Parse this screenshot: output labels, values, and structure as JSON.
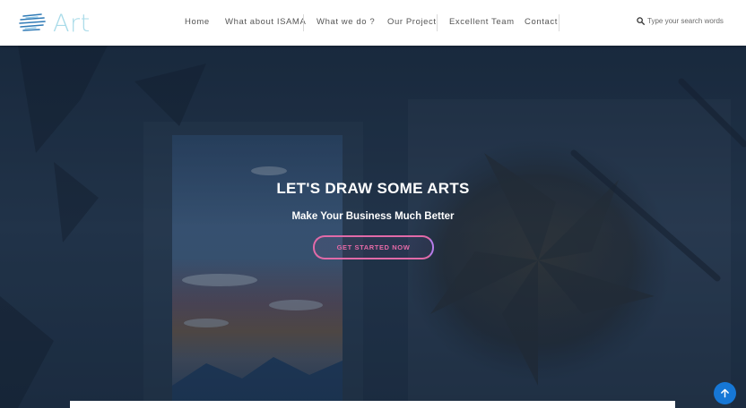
{
  "brand": {
    "name": "Art"
  },
  "nav": {
    "items": [
      "Home",
      "What about ISAMA",
      "What we do ?",
      "Our Project",
      "Excellent Team",
      "Contact"
    ]
  },
  "search": {
    "placeholder": "Type your search words"
  },
  "hero": {
    "title": "LET'S DRAW SOME ARTS",
    "subtitle": "Make Your Business Much Better",
    "cta_label": "GET STARTED NOW"
  },
  "colors": {
    "accent_pink": "#e067a6",
    "accent_blue": "#1677d6",
    "logo": "#a9dbe9",
    "hero_overlay": "#1d2f45"
  },
  "icons": {
    "search": "magnifier-icon",
    "scroll_top": "arrow-up-icon",
    "logo": "stripes-logo-icon"
  }
}
